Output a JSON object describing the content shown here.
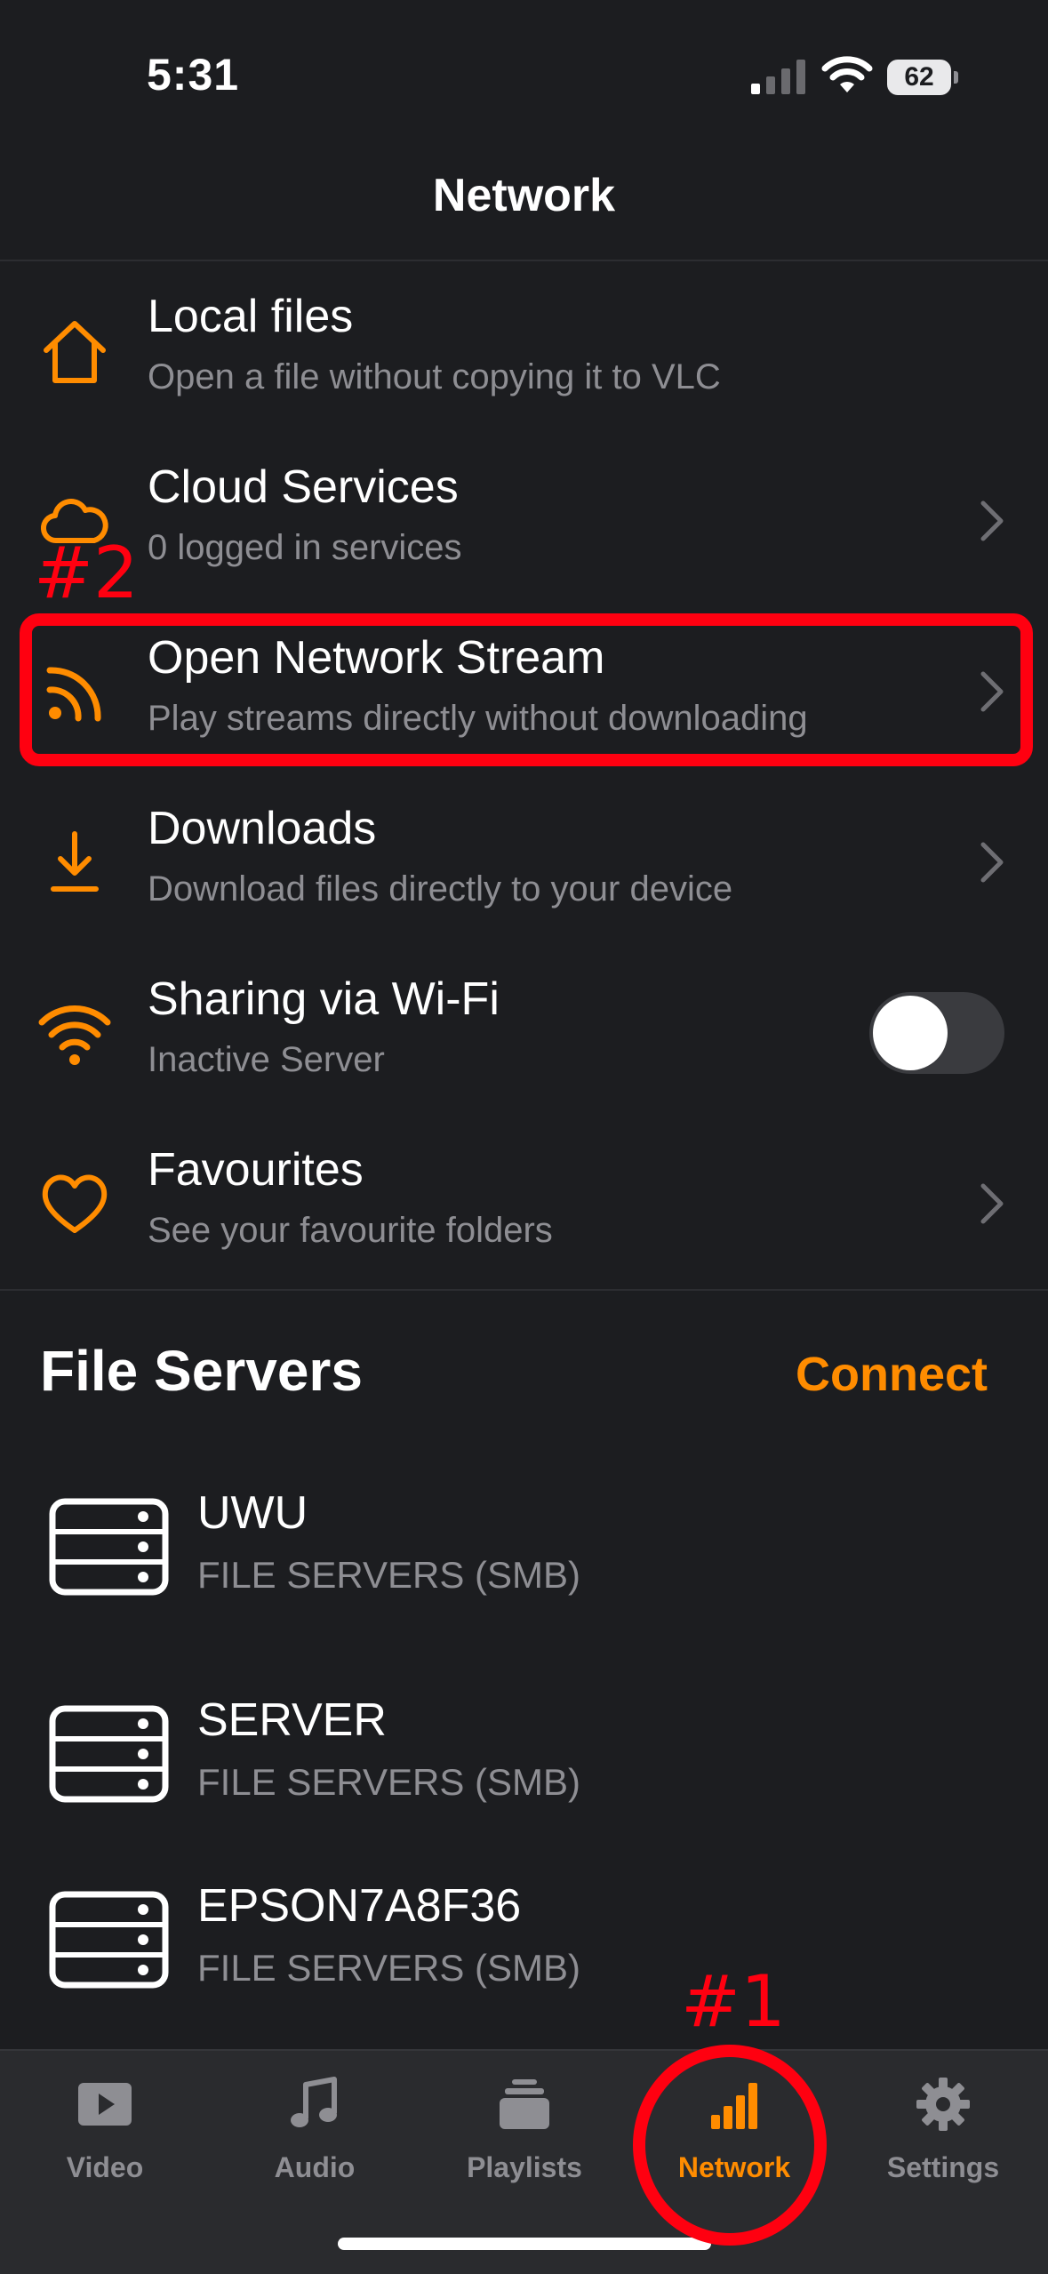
{
  "status_bar": {
    "time": "5:31",
    "battery": "62"
  },
  "header": {
    "title": "Network"
  },
  "menu": [
    {
      "title": "Local files",
      "subtitle": "Open a file without copying it to VLC",
      "icon": "home-icon"
    },
    {
      "title": "Cloud Services",
      "subtitle": "0 logged in services",
      "icon": "cloud-icon"
    },
    {
      "title": "Open Network Stream",
      "subtitle": "Play streams directly without downloading",
      "icon": "rss-icon"
    },
    {
      "title": "Downloads",
      "subtitle": "Download files directly to your device",
      "icon": "download-icon"
    },
    {
      "title": "Sharing via Wi-Fi",
      "subtitle": "Inactive Server",
      "icon": "wifi-icon",
      "toggle_on": false
    },
    {
      "title": "Favourites",
      "subtitle": "See your favourite folders",
      "icon": "heart-icon"
    }
  ],
  "file_servers": {
    "title": "File Servers",
    "connect_label": "Connect",
    "items": [
      {
        "name": "UWU",
        "type": "FILE SERVERS (SMB)"
      },
      {
        "name": "SERVER",
        "type": "FILE SERVERS (SMB)"
      },
      {
        "name": "EPSON7A8F36",
        "type": "FILE SERVERS (SMB)"
      }
    ]
  },
  "tabbar": {
    "tabs": [
      {
        "label": "Video",
        "icon": "play-icon"
      },
      {
        "label": "Audio",
        "icon": "music-note-icon"
      },
      {
        "label": "Playlists",
        "icon": "playlist-icon"
      },
      {
        "label": "Network",
        "icon": "network-bars-icon",
        "active": true
      },
      {
        "label": "Settings",
        "icon": "gear-icon"
      }
    ]
  },
  "annotations": {
    "label_1": "#1",
    "label_2": "#2"
  },
  "colors": {
    "accent": "#ff8c00",
    "background": "#1c1d20",
    "annotation": "#ff0010"
  }
}
